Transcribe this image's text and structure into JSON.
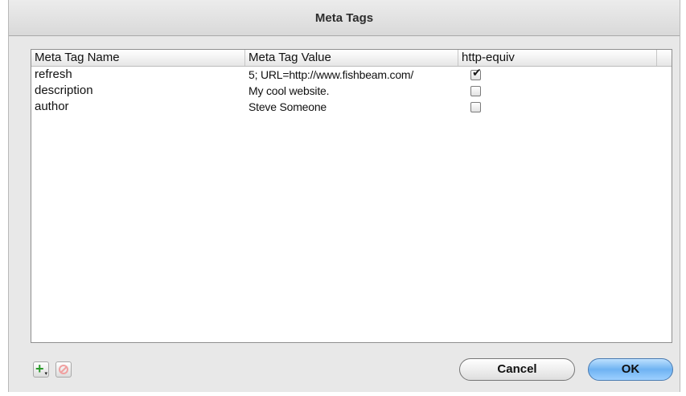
{
  "window": {
    "title": "Meta Tags"
  },
  "table": {
    "columns": [
      "Meta Tag Name",
      "Meta Tag Value",
      "http-equiv"
    ],
    "rows": [
      {
        "name": "refresh",
        "value": "5; URL=http://www.fishbeam.com/",
        "http_equiv": true
      },
      {
        "name": "description",
        "value": "My cool website.",
        "http_equiv": false
      },
      {
        "name": "author",
        "value": "Steve Someone",
        "http_equiv": false
      }
    ]
  },
  "buttons": {
    "cancel": "Cancel",
    "ok": "OK"
  },
  "icons": {
    "add": "plus-icon",
    "remove": "no-entry-icon"
  },
  "colors": {
    "ok_accent": "#6fb3f2",
    "add_green": "#2a9a2a",
    "remove_red": "#f0a0a0"
  }
}
